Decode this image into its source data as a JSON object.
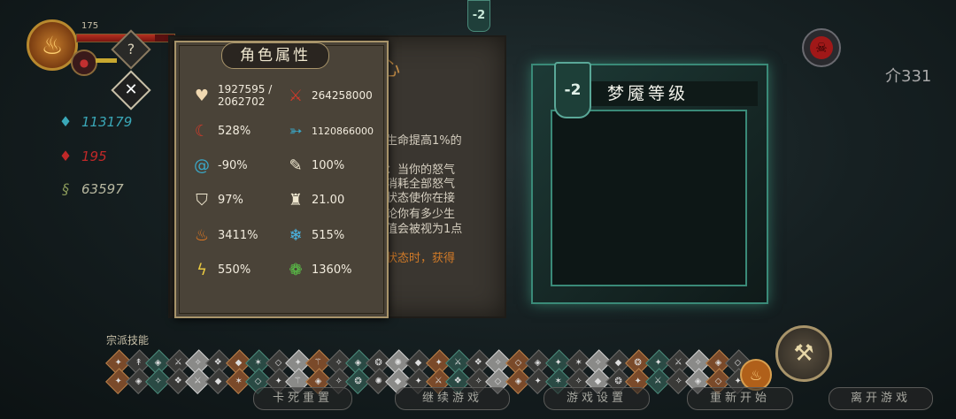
{
  "player": {
    "level": "175",
    "hp_fill": 0.8,
    "resources": [
      {
        "icon": "blue-flame-icon",
        "value": "113179",
        "color": "#3aa8b8"
      },
      {
        "icon": "red-flame-icon",
        "value": "195",
        "color": "#c02828"
      },
      {
        "icon": "green-spiral-icon",
        "value": "63597",
        "color": "#b8b8a0"
      }
    ]
  },
  "top_badge": "-2",
  "currency": {
    "icon": "currency-icon",
    "value": "331"
  },
  "help_button": "?",
  "close_button": "✕",
  "document": {
    "title": "心",
    "lines": [
      {
        "text": "生命提高1%的",
        "highlight": ""
      },
      {
        "text": "：当你的怒气",
        "highlight": ""
      },
      {
        "text": "消耗全部怒气",
        "highlight": ""
      },
      {
        "text": "状态使你在接",
        "highlight": ""
      },
      {
        "text": "论你有多少生",
        "highlight": ""
      },
      {
        "text": "值会被视为1点",
        "highlight": ""
      },
      {
        "text": "",
        "highlight": "状态时，获得"
      }
    ]
  },
  "attributes": {
    "title": "角色属性",
    "stats": [
      {
        "icon": "heart-icon",
        "value": "1927595 / 2062702",
        "color": "#f0d8b0"
      },
      {
        "icon": "red-sword-icon",
        "value": "264258000",
        "color": "#d03a2a"
      },
      {
        "icon": "red-crescent-icon",
        "value": "528%",
        "color": "#d03a2a"
      },
      {
        "icon": "blue-dash-icon",
        "value": "1120866000",
        "color": "#3aa8c8"
      },
      {
        "icon": "blue-swirl-icon",
        "value": "-90%",
        "color": "#3aa8c8"
      },
      {
        "icon": "cracked-shield-icon",
        "value": "100%",
        "color": "#f0e8d0"
      },
      {
        "icon": "shield-icon",
        "value": "97%",
        "color": "#f0e8d0"
      },
      {
        "icon": "armor-icon",
        "value": "21.00",
        "color": "#f0e8d0"
      },
      {
        "icon": "fire-icon",
        "value": "3411%",
        "color": "#e87a20"
      },
      {
        "icon": "snowflake-icon",
        "value": "515%",
        "color": "#4ab8e8"
      },
      {
        "icon": "lightning-icon",
        "value": "550%",
        "color": "#e8c840"
      },
      {
        "icon": "poison-icon",
        "value": "1360%",
        "color": "#5ac848"
      }
    ]
  },
  "dream_panel": {
    "badge": "-2",
    "title": "梦魇等级"
  },
  "skills": {
    "label": "宗派技能",
    "row1": [
      "✦",
      "↟",
      "◈",
      "⚔",
      "✧",
      "❖",
      "◆",
      "✶",
      "◇",
      "✦",
      "⚚",
      "✧",
      "◈",
      "❂",
      "✺",
      "◆",
      "✦",
      "⚔",
      "❖",
      "✧",
      "◇",
      "◈",
      "✦",
      "✶",
      "✧",
      "◆",
      "❂",
      "✦",
      "⚔",
      "✧",
      "◈",
      "◇"
    ],
    "row2": [
      "✦",
      "◈",
      "✧",
      "❖",
      "⚔",
      "◆",
      "✶",
      "◇",
      "✦",
      "⚚",
      "◈",
      "✧",
      "❂",
      "✺",
      "◆",
      "✦",
      "⚔",
      "❖",
      "✧",
      "◇",
      "◈",
      "✦",
      "✶",
      "✧",
      "◆",
      "❂",
      "✦",
      "⚔",
      "✧",
      "◈",
      "◇",
      "✦"
    ]
  },
  "menu": {
    "reset_card": "卡死重置",
    "continue": "继续游戏",
    "settings": "游戏设置",
    "restart": "重新开始",
    "leave": "离开游戏"
  }
}
